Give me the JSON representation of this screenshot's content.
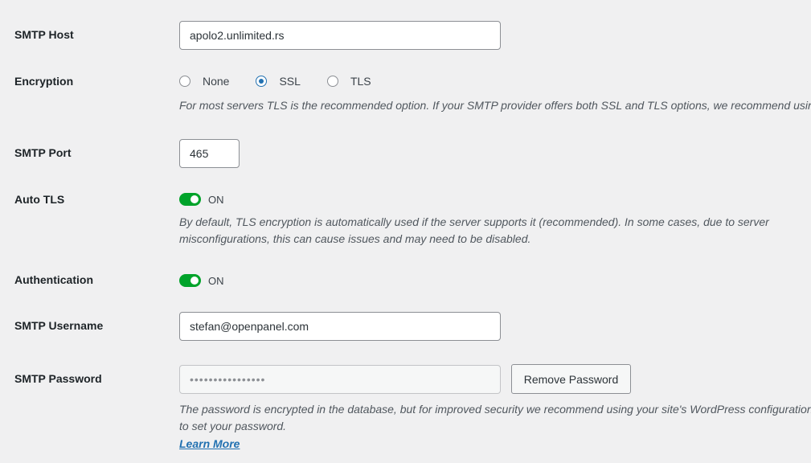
{
  "smtp_host": {
    "label": "SMTP Host",
    "value": "apolo2.unlimited.rs"
  },
  "encryption": {
    "label": "Encryption",
    "options": [
      "None",
      "SSL",
      "TLS"
    ],
    "selected": "SSL",
    "description": "For most servers TLS is the recommended option. If your SMTP provider offers both SSL and TLS options, we recommend using TLS."
  },
  "smtp_port": {
    "label": "SMTP Port",
    "value": "465"
  },
  "auto_tls": {
    "label": "Auto TLS",
    "state": "ON",
    "description_line1": "By default, TLS encryption is automatically used if the server supports it (recommended). In some cases, due to server",
    "description_line2": "misconfigurations, this can cause issues and may need to be disabled."
  },
  "authentication": {
    "label": "Authentication",
    "state": "ON"
  },
  "smtp_username": {
    "label": "SMTP Username",
    "value": "stefan@openpanel.com"
  },
  "smtp_password": {
    "label": "SMTP Password",
    "masked_value": "••••••••••••••••",
    "remove_button": "Remove Password",
    "description_line1": "The password is encrypted in the database, but for improved security we recommend using your site's WordPress configuration file",
    "description_line2": "to set your password.",
    "learn_more": "Learn More"
  },
  "colors": {
    "accent": "#2271b1",
    "toggle_on": "#00a32a",
    "background": "#f0f0f1"
  },
  "icons": {
    "radio": "radio-circle",
    "toggle": "toggle-switch"
  }
}
